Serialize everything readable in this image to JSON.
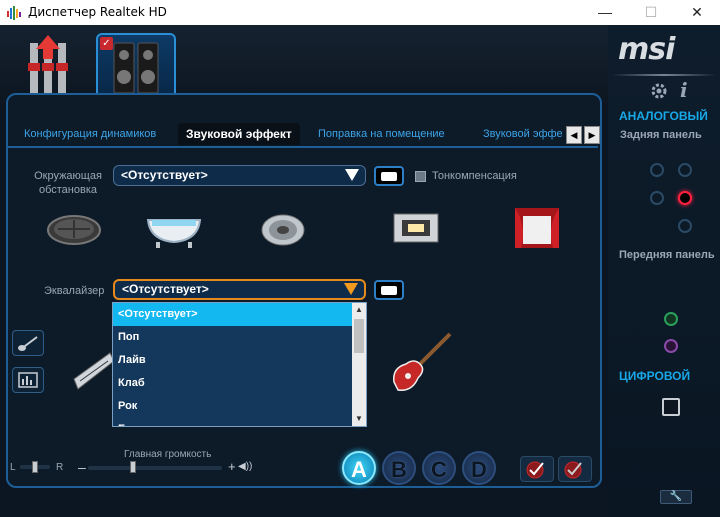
{
  "window": {
    "title": "Диспетчер Realtek HD",
    "minimize": "—",
    "maximize": "☐",
    "close": "✕"
  },
  "tabs": [
    {
      "label": "Конфигурация динамиков"
    },
    {
      "label": "Звуковой эффект"
    },
    {
      "label": "Поправка на помещение"
    },
    {
      "label": "Звуковой эффе"
    }
  ],
  "tab_scroll": {
    "left": "◀",
    "right": "▶"
  },
  "environment": {
    "label_line1": "Окружающая",
    "label_line2": "обстановка",
    "value": "<Отсутствует>",
    "loudness_label": "Тонкомпенсация",
    "icons": [
      "sewer-icon",
      "bathtub-icon",
      "disc-arena-icon",
      "stone-room-icon",
      "theater-icon"
    ]
  },
  "equalizer": {
    "label": "Эквалайзер",
    "value": "<Отсутствует>",
    "options": [
      "<Отсутствует>",
      "Поп",
      "Лайв",
      "Клаб",
      "Рок",
      "Б"
    ]
  },
  "volume": {
    "main_label": "Главная громкость",
    "left": "L",
    "right": "R",
    "plus": "+",
    "speaker_glyph": "◀))"
  },
  "presets": [
    "A",
    "B",
    "C",
    "D"
  ],
  "right_panel": {
    "logo": "msi",
    "analog_heading": "АНАЛОГОВЫЙ",
    "rear_panel": "Задняя панель",
    "front_panel": "Передняя панель",
    "digital_heading": "ЦИФРОВОЙ"
  },
  "colors": {
    "accent": "#17a8e8",
    "selected_item": "#14b8f0",
    "focus_border": "#e48a1c",
    "active_jack": "#ff2040"
  }
}
